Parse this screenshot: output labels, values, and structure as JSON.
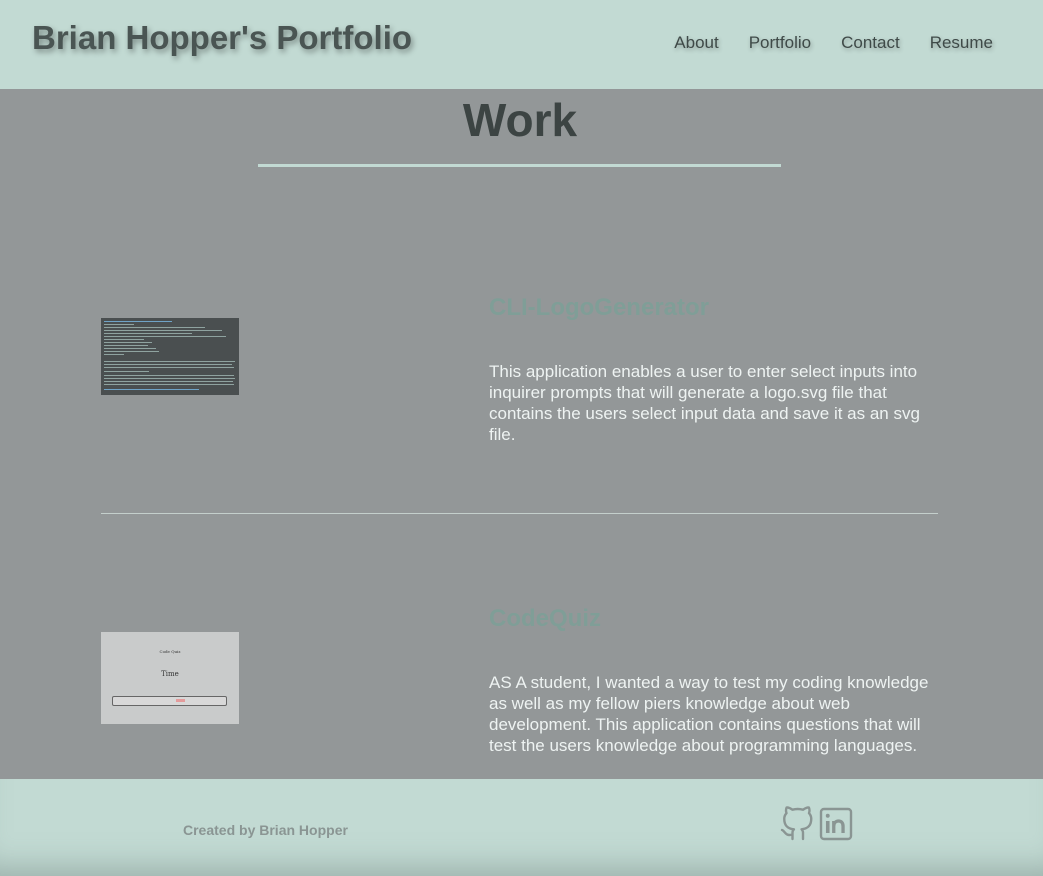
{
  "header": {
    "title": "Brian Hopper's Portfolio",
    "nav": [
      "About",
      "Portfolio",
      "Contact",
      "Resume"
    ]
  },
  "work": {
    "title": "Work",
    "projects": [
      {
        "name": "CLI-LogoGenerator",
        "description": "This application enables a user to enter select inputs into inquirer prompts that will generate a logo.svg file that contains the users select input data and save it as an svg file.",
        "thumbnail": "terminal-screenshot"
      },
      {
        "name": "CodeQuiz",
        "description": "AS A student, I wanted a way to test my coding knowledge as well as my fellow piers knowledge about web development. This application contains questions that will test the users knowledge about programming languages.",
        "thumbnail": "quiz-screenshot",
        "thumbnail_text": {
          "heading": "Code Quiz",
          "timer": "Time"
        }
      }
    ]
  },
  "footer": {
    "credit": "Created by Brian Hopper",
    "icons": [
      "github-icon",
      "linkedin-icon"
    ]
  },
  "colors": {
    "header_bg": "#c2dad3",
    "main_bg": "#939798",
    "project_title": "#7f9e97"
  }
}
